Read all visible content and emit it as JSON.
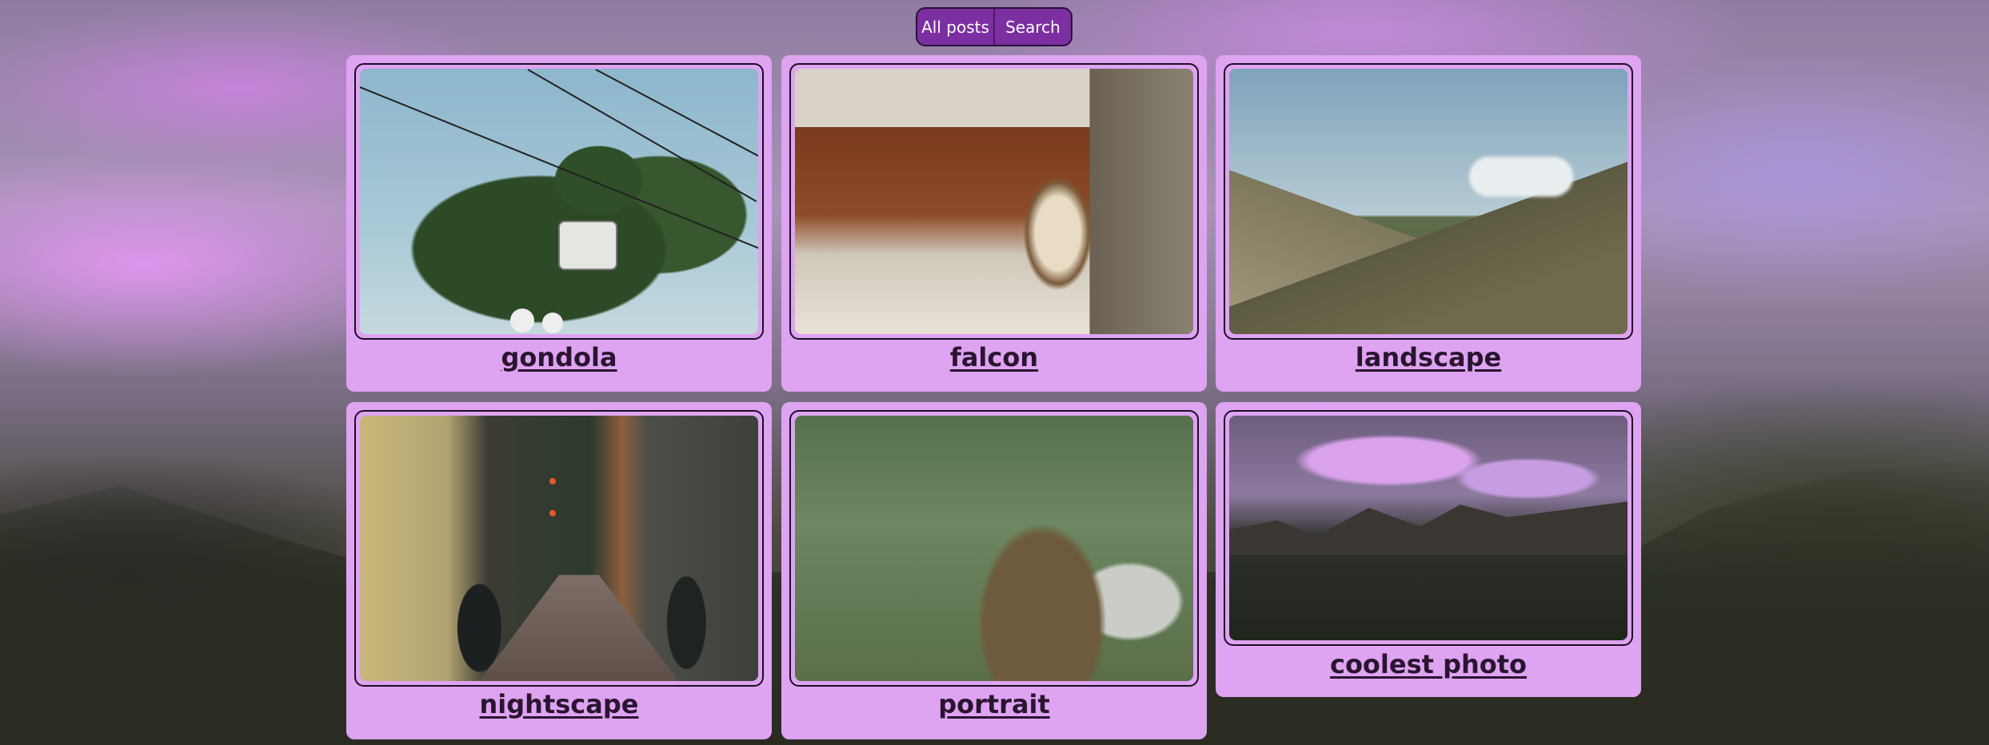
{
  "nav": {
    "all_posts": "All posts",
    "search": "Search"
  },
  "gallery": {
    "posts": [
      {
        "caption": "gondola"
      },
      {
        "caption": "falcon"
      },
      {
        "caption": "landscape"
      },
      {
        "caption": "nightscape"
      },
      {
        "caption": "portrait"
      },
      {
        "caption": "coolest photo"
      }
    ]
  },
  "colors": {
    "card_background": "#dea3f1",
    "nav_background": "#7c2fa1",
    "caption_text": "#2a1530"
  }
}
